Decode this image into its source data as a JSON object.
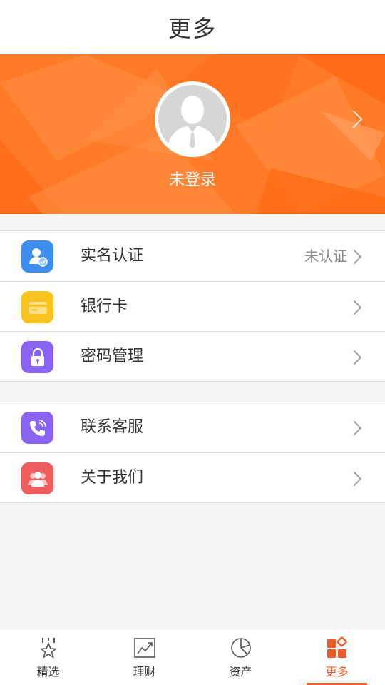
{
  "header": {
    "title": "更多"
  },
  "profile": {
    "login_status": "未登录"
  },
  "menu_group_1": [
    {
      "label": "实名认证",
      "status": "未认证",
      "icon": "id-verify-icon",
      "color": "#3d8ef0"
    },
    {
      "label": "银行卡",
      "status": "",
      "icon": "bank-card-icon",
      "color": "#f9c21e"
    },
    {
      "label": "密码管理",
      "status": "",
      "icon": "lock-icon",
      "color": "#8a63f2"
    }
  ],
  "menu_group_2": [
    {
      "label": "联系客服",
      "icon": "phone-icon",
      "color": "#8a63f2"
    },
    {
      "label": "关于我们",
      "icon": "people-icon",
      "color": "#ee5e5e"
    }
  ],
  "tabbar": {
    "tabs": [
      {
        "label": "精选",
        "icon": "star-icon",
        "active": false
      },
      {
        "label": "理财",
        "icon": "trend-chart-icon",
        "active": false
      },
      {
        "label": "资产",
        "icon": "pie-chart-icon",
        "active": false
      },
      {
        "label": "更多",
        "icon": "more-grid-icon",
        "active": true
      }
    ],
    "active_color": "#f05a28"
  },
  "colors": {
    "banner": "#ff7a26",
    "accent": "#f05a28"
  }
}
